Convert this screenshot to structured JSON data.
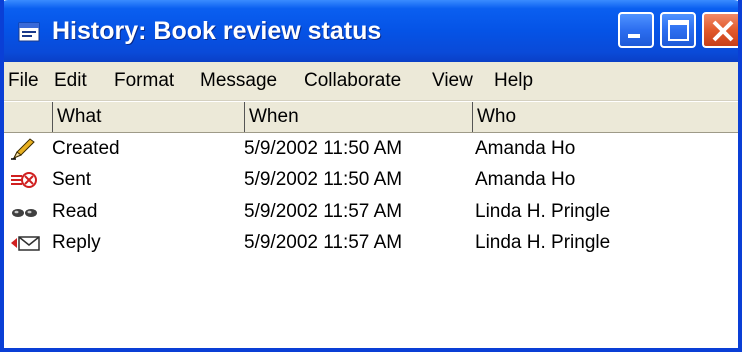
{
  "window": {
    "title": "History: Book review status",
    "title_color": "#ffffff",
    "titlebar_color": "#0553e6",
    "close_color": "#e25a2c"
  },
  "menu": {
    "items": [
      "File",
      "Edit",
      "Format",
      "Message",
      "Collaborate",
      "View",
      "Help"
    ]
  },
  "table": {
    "columns": [
      "What",
      "When",
      "Who"
    ],
    "rows": [
      {
        "icon": "pencil-icon",
        "what": "Created",
        "when": "5/9/2002  11:50 AM",
        "who": "Amanda Ho"
      },
      {
        "icon": "sent-arrows-icon",
        "what": "Sent",
        "when": "5/9/2002  11:50 AM",
        "who": "Amanda Ho"
      },
      {
        "icon": "glasses-icon",
        "what": "Read",
        "when": "5/9/2002  11:57 AM",
        "who": "Linda H. Pringle"
      },
      {
        "icon": "reply-envelope-icon",
        "what": "Reply",
        "when": "5/9/2002  11:57 AM",
        "who": "Linda H. Pringle"
      }
    ]
  }
}
